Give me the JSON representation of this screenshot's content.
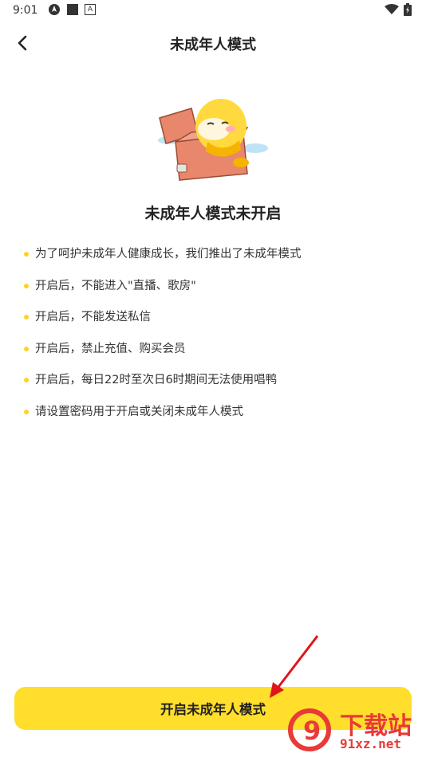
{
  "status_bar": {
    "time": "9:01",
    "left_icons": [
      "navigation-icon",
      "square-icon",
      "a-box-icon"
    ],
    "right_icons": [
      "wifi-icon",
      "battery-icon"
    ]
  },
  "header": {
    "back_icon": "back-arrow-icon",
    "title": "未成年人模式"
  },
  "main": {
    "illustration": "duck-in-treasure-chest",
    "status_title": "未成年人模式未开启",
    "rules": [
      "为了呵护未成年人健康成长，我们推出了未成年模式",
      "开启后，不能进入\"直播、歌房\"",
      "开启后，不能发送私信",
      "开启后，禁止充值、购买会员",
      "开启后，每日22时至次日6时期间无法使用唱鸭",
      "请设置密码用于开启或关闭未成年人模式"
    ]
  },
  "footer": {
    "cta_label": "开启未成年人模式"
  },
  "watermark": {
    "logo_number": "9",
    "text_top": "下载站",
    "text_bottom": "91xz.net"
  },
  "colors": {
    "accent": "#ffde2c",
    "bullet": "#ffd21f",
    "annotation_arrow": "#e0151a",
    "watermark": "#e83a37"
  }
}
